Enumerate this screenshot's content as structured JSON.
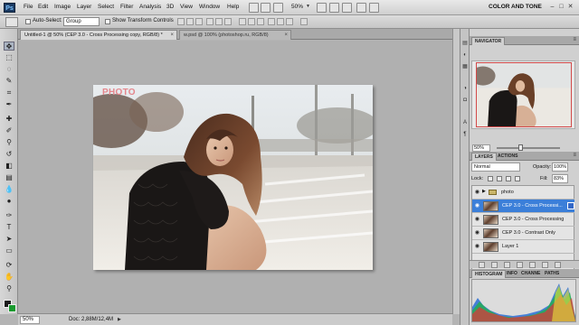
{
  "menubar": {
    "logo": "Ps",
    "items": [
      "File",
      "Edit",
      "Image",
      "Layer",
      "Select",
      "Filter",
      "Analysis",
      "3D",
      "View",
      "Window",
      "Help"
    ],
    "zoom": "50%",
    "workspace": "COLOR AND TONE",
    "window_buttons": [
      "–",
      "□",
      "✕"
    ]
  },
  "options": {
    "auto_select_label": "Auto-Select:",
    "auto_select_value": "Group",
    "show_transform_label": "Show Transform Controls"
  },
  "documents": {
    "tabs": [
      {
        "label": "Untitled-1 @ 50% (CEP 3.0 - Cross Processing copy, RGB/8) *",
        "active": true
      },
      {
        "label": "w.psd @ 100% (photoshop.ru, RGB/8)",
        "active": false
      }
    ],
    "close": "×"
  },
  "canvas": {
    "photo_label": "PHOTO"
  },
  "statusbar": {
    "zoom": "50%",
    "doc_info": "Doc: 2,88M/12,4M",
    "arrow": "▶"
  },
  "navigator": {
    "tab": "NAVIGATOR",
    "zoom": "50%"
  },
  "layers": {
    "tabs": [
      "LAYERS",
      "ACTIONS"
    ],
    "blend_mode": "Normal",
    "opacity_label": "Opacity:",
    "opacity_value": "100%",
    "lock_label": "Lock:",
    "fill_label": "Fill:",
    "fill_value": "83%",
    "rows": [
      {
        "name": "photo",
        "type": "group",
        "selected": false
      },
      {
        "name": "CEP 3.0 - Cross Processi...",
        "type": "layer",
        "selected": true
      },
      {
        "name": "CEP 3.0 - Cross Processing",
        "type": "layer",
        "selected": false
      },
      {
        "name": "CEP 3.0 - Contrast Only",
        "type": "layer",
        "selected": false
      },
      {
        "name": "Layer 1",
        "type": "layer",
        "selected": false
      }
    ]
  },
  "histogram": {
    "tabs": [
      "HISTOGRAM",
      "INFO",
      "CHANNE",
      "PATHS"
    ]
  },
  "colors": {
    "accent": "#3b7fd9",
    "photo_label": "#e4868c",
    "foreground": "#1c1c1c",
    "background": "#1a9a2f"
  }
}
